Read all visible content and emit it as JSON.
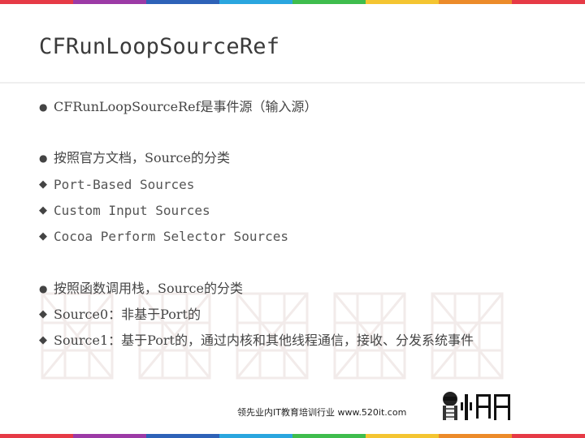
{
  "slide": {
    "title": "CFRunLoopSourceRef",
    "stripe_colors": [
      "#e63a46",
      "#9c3aa6",
      "#2e62b8",
      "#2aa6df",
      "#3fbd4d",
      "#f4c531",
      "#ec8b2a",
      "#e63a46"
    ],
    "bullets": [
      {
        "marker": "dot",
        "text": "CFRunLoopSourceRef是事件源（输入源）"
      },
      {
        "marker": "dot",
        "text": "按照官方文档，Source的分类"
      },
      {
        "marker": "diamond",
        "text": "Port-Based Sources"
      },
      {
        "marker": "diamond",
        "text": "Custom Input Sources"
      },
      {
        "marker": "diamond",
        "text": "Cocoa Perform Selector Sources"
      },
      {
        "marker": "dot",
        "text": "按照函数调用栈，Source的分类"
      },
      {
        "marker": "diamond",
        "text": "Source0：非基于Port的"
      },
      {
        "marker": "diamond",
        "text": "Source1：基于Port的，通过内核和其他线程通信，接收、分发系统事件"
      }
    ]
  },
  "footer": {
    "text": "领先业内IT教育培训行业 www.520it.com",
    "logo_text": "小码哥"
  }
}
